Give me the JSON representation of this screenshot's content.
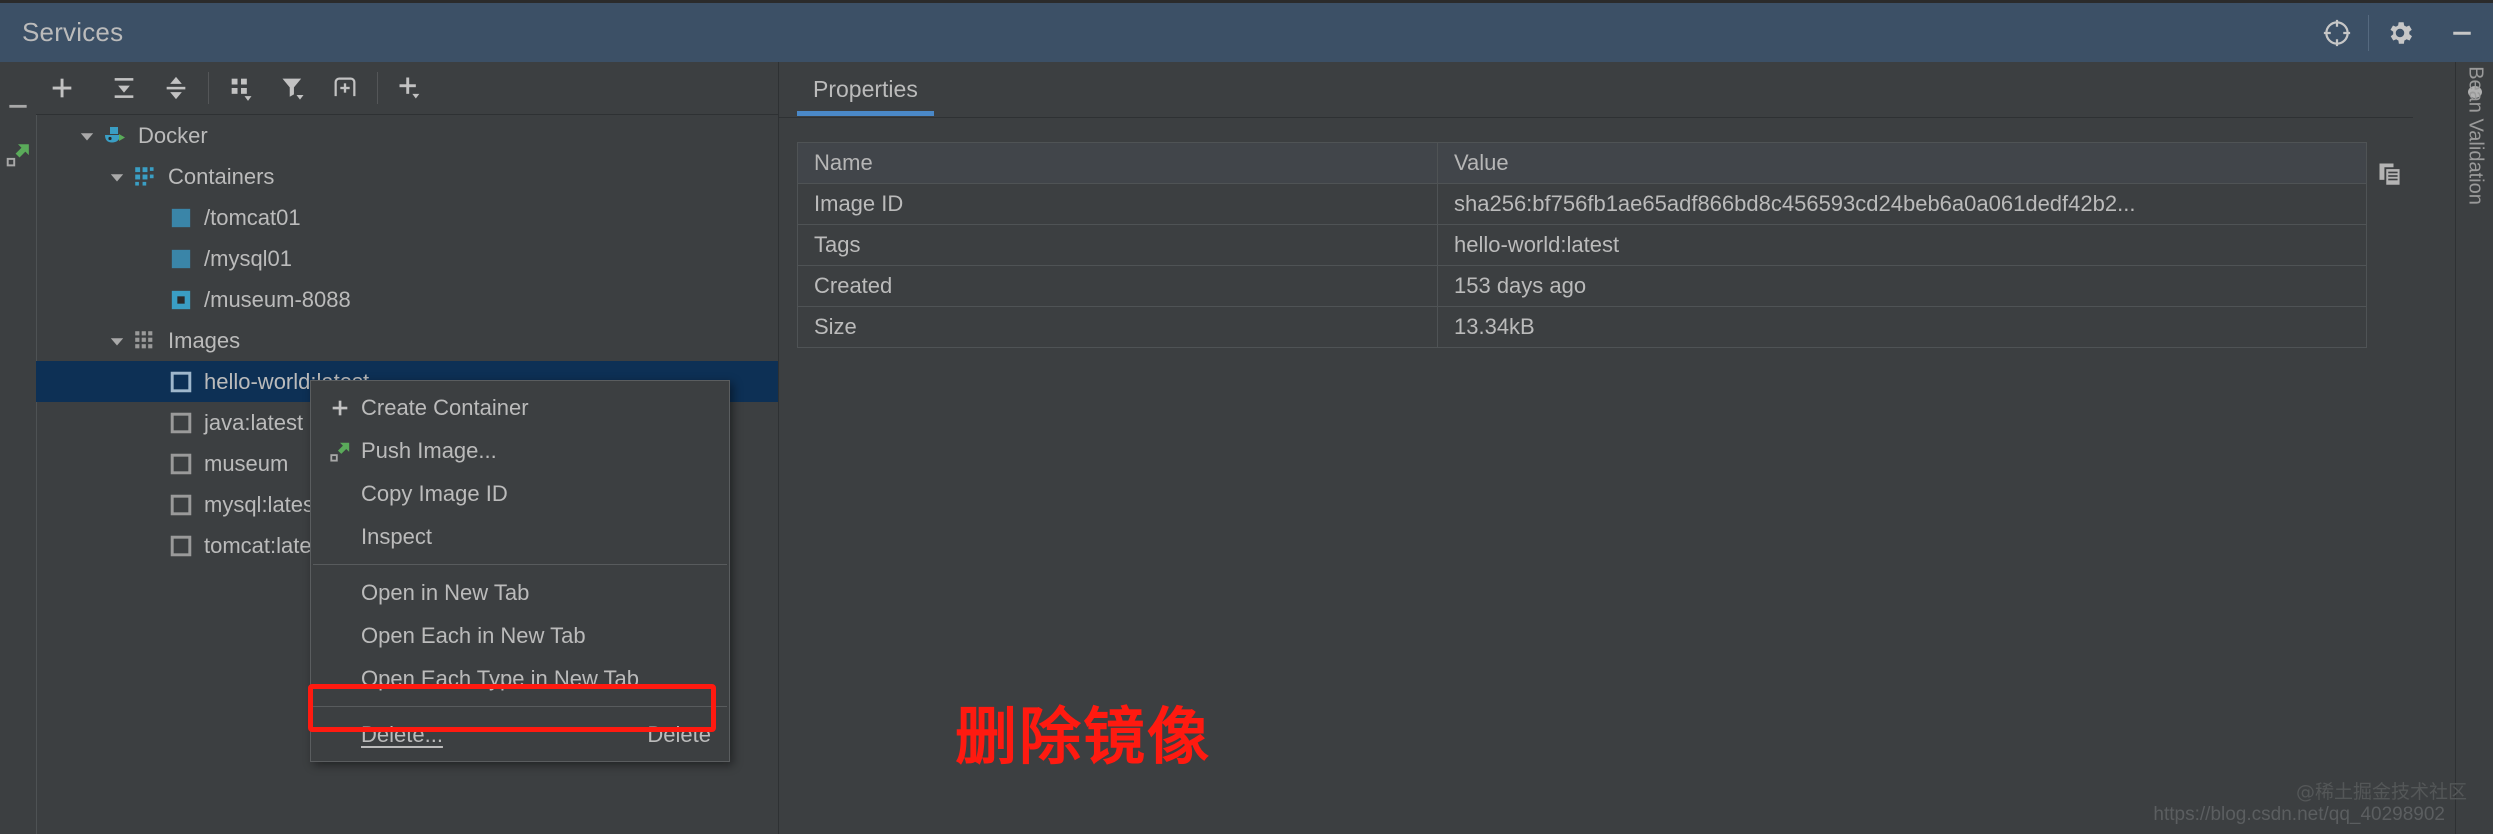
{
  "window": {
    "title": "Services",
    "titlebar_icons": [
      "target-icon",
      "gear-icon",
      "minimize-icon"
    ]
  },
  "left_strip": {
    "buttons": [
      {
        "name": "collapse-minus-button",
        "icon": "minus-icon"
      },
      {
        "name": "push-image-button",
        "icon": "push-arrow-icon"
      }
    ]
  },
  "tree_toolbar": {
    "buttons": [
      {
        "name": "add-service-button",
        "icon": "plus-icon",
        "label": ""
      },
      {
        "name": "expand-all-button",
        "icon": "expand-all-icon",
        "label": ""
      },
      {
        "name": "collapse-all-button",
        "icon": "collapse-all-icon",
        "label": ""
      },
      {
        "name": "group-by-button",
        "icon": "group-by-icon",
        "label": ""
      },
      {
        "name": "filter-button",
        "icon": "filter-icon",
        "label": ""
      },
      {
        "name": "new-tab-button",
        "icon": "new-tab-icon",
        "label": ""
      },
      {
        "name": "add-dropdown-button",
        "icon": "plus-dropdown-icon",
        "label": ""
      }
    ]
  },
  "tree": {
    "nodes": [
      {
        "label": "Docker",
        "depth": 0,
        "icon": "docker-whale-icon",
        "twist": "expanded",
        "selected": false
      },
      {
        "label": "Containers",
        "depth": 1,
        "icon": "containers-grid-icon",
        "twist": "expanded",
        "selected": false
      },
      {
        "label": "/tomcat01",
        "depth": 2,
        "icon": "container-running-icon",
        "twist": "none",
        "selected": false
      },
      {
        "label": "/mysql01",
        "depth": 2,
        "icon": "container-running-icon",
        "twist": "none",
        "selected": false
      },
      {
        "label": "/museum-8088",
        "depth": 2,
        "icon": "container-stopped-icon",
        "twist": "none",
        "selected": false
      },
      {
        "label": "Images",
        "depth": 1,
        "icon": "images-grid-icon",
        "twist": "expanded",
        "selected": false
      },
      {
        "label": "hello-world:latest",
        "depth": 2,
        "icon": "image-square-icon",
        "twist": "none",
        "selected": true
      },
      {
        "label": "java:latest",
        "depth": 2,
        "icon": "image-square-icon",
        "twist": "none",
        "selected": false
      },
      {
        "label": "museum",
        "depth": 2,
        "icon": "image-square-icon",
        "twist": "none",
        "selected": false
      },
      {
        "label": "mysql:latest",
        "depth": 2,
        "icon": "image-square-icon",
        "twist": "none",
        "selected": false
      },
      {
        "label": "tomcat:latest",
        "depth": 2,
        "icon": "image-square-icon",
        "twist": "none",
        "selected": false
      }
    ]
  },
  "properties_panel": {
    "tab_label": "Properties",
    "columns": [
      "Name",
      "Value"
    ],
    "rows": [
      {
        "name": "Image ID",
        "value": "sha256:bf756fb1ae65adf866bd8c456593cd24beb6a0a061dedf42b2..."
      },
      {
        "name": "Tags",
        "value": "hello-world:latest"
      },
      {
        "name": "Created",
        "value": "153 days ago"
      },
      {
        "name": "Size",
        "value": "13.34kB"
      }
    ],
    "copy_button": "copy-icon"
  },
  "context_menu": {
    "items": [
      {
        "label": "Create Container",
        "icon": "plus-icon",
        "accel": "",
        "separator_after": false,
        "highlighted": false
      },
      {
        "label": "Push Image...",
        "icon": "push-arrow-icon",
        "accel": "",
        "separator_after": false,
        "highlighted": false
      },
      {
        "label": "Copy Image ID",
        "icon": "",
        "accel": "",
        "separator_after": false,
        "highlighted": false
      },
      {
        "label": "Inspect",
        "icon": "",
        "accel": "",
        "separator_after": true,
        "highlighted": false
      },
      {
        "label": "Open in New Tab",
        "icon": "",
        "accel": "",
        "separator_after": false,
        "highlighted": false
      },
      {
        "label": "Open Each in New Tab",
        "icon": "",
        "accel": "",
        "separator_after": false,
        "highlighted": false
      },
      {
        "label": "Open Each Type in New Tab",
        "icon": "",
        "accel": "",
        "separator_after": true,
        "highlighted": false
      },
      {
        "label": "Delete...",
        "icon": "",
        "accel": "Delete",
        "separator_after": false,
        "highlighted": true
      }
    ]
  },
  "annotation": {
    "text": "删除镜像",
    "color": "#ff1a10"
  },
  "right_bar": {
    "label": "Bean Validation",
    "icon": "bean-validation-icon"
  },
  "watermarks": {
    "author": "@稀土掘金技术社区",
    "url": "https://blog.csdn.net/qq_40298902"
  },
  "colors": {
    "titlebar_bg": "#3c5066",
    "panel_bg": "#3c3f41",
    "selection_bg": "#0d3055",
    "accent_blue": "#4a88c7",
    "highlight_red": "#ff1a10",
    "docker_blue": "#3a9ec4"
  }
}
